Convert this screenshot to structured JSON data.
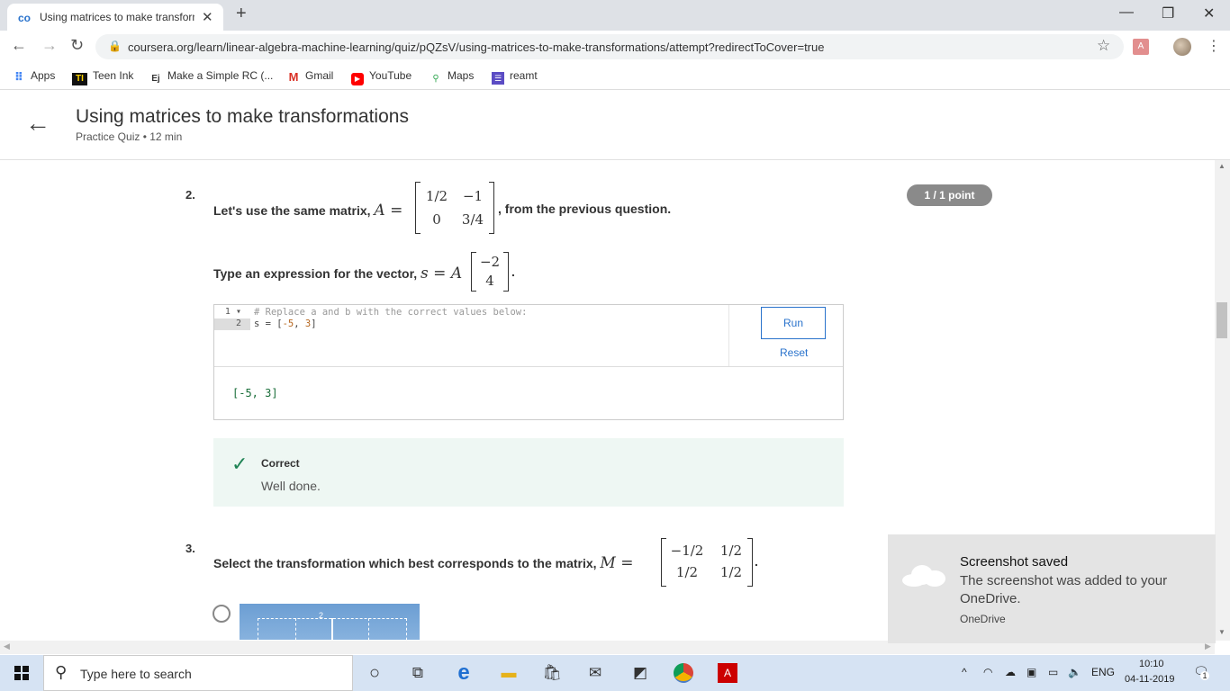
{
  "browser": {
    "tab_title": "Using matrices to make transform",
    "favicon": "co",
    "url": "coursera.org/learn/linear-algebra-machine-learning/quiz/pQZsV/using-matrices-to-make-transformations/attempt?redirectToCover=true",
    "bookmarks": [
      {
        "label": "Apps",
        "icon": "apps-grid-icon"
      },
      {
        "label": "Teen Ink",
        "icon": "TI"
      },
      {
        "label": "Make a Simple RC (...",
        "icon": "Ej"
      },
      {
        "label": "Gmail",
        "icon": "M"
      },
      {
        "label": "YouTube",
        "icon": "youtube-icon"
      },
      {
        "label": "Maps",
        "icon": "maps-icon"
      },
      {
        "label": "reamt",
        "icon": "list-icon"
      }
    ]
  },
  "header": {
    "title": "Using matrices to make transformations",
    "subtitle": "Practice Quiz • 12 min"
  },
  "q2": {
    "number": "2.",
    "text_before": "Let's use the same matrix, ",
    "var_A": "A =",
    "text_after": ", from the previous question.",
    "matrix": [
      [
        "1/2",
        "−1"
      ],
      [
        "0",
        "3/4"
      ]
    ],
    "points": "1 / 1 point",
    "prompt_before": "Type an expression for the vector, ",
    "prompt_math": "s = A",
    "vector": [
      "−2",
      "4"
    ],
    "prompt_end": ".",
    "code": {
      "line_numbers": [
        "1",
        "2"
      ],
      "line1": "# Replace a and b with the correct values below:",
      "line2_prefix": "s = [",
      "line2_a": "-5",
      "line2_sep": ", ",
      "line2_b": "3",
      "line2_suffix": "]"
    },
    "run_label": "Run",
    "reset_label": "Reset",
    "output": "[-5, 3]",
    "feedback_title": "Correct",
    "feedback_msg": "Well done."
  },
  "q3": {
    "number": "3.",
    "text": "Select the transformation which best corresponds to the matrix, ",
    "var_M": "M =",
    "matrix": [
      [
        "−1/2",
        "1/2"
      ],
      [
        "1/2",
        "1/2"
      ]
    ],
    "end": ".",
    "option_label": "2"
  },
  "toast": {
    "title": "Screenshot saved",
    "body": "The screenshot was added to your OneDrive.",
    "source": "OneDrive"
  },
  "taskbar": {
    "search_placeholder": "Type here to search",
    "lang": "ENG",
    "time": "10:10",
    "date": "04-11-2019",
    "notif_count": "1"
  }
}
